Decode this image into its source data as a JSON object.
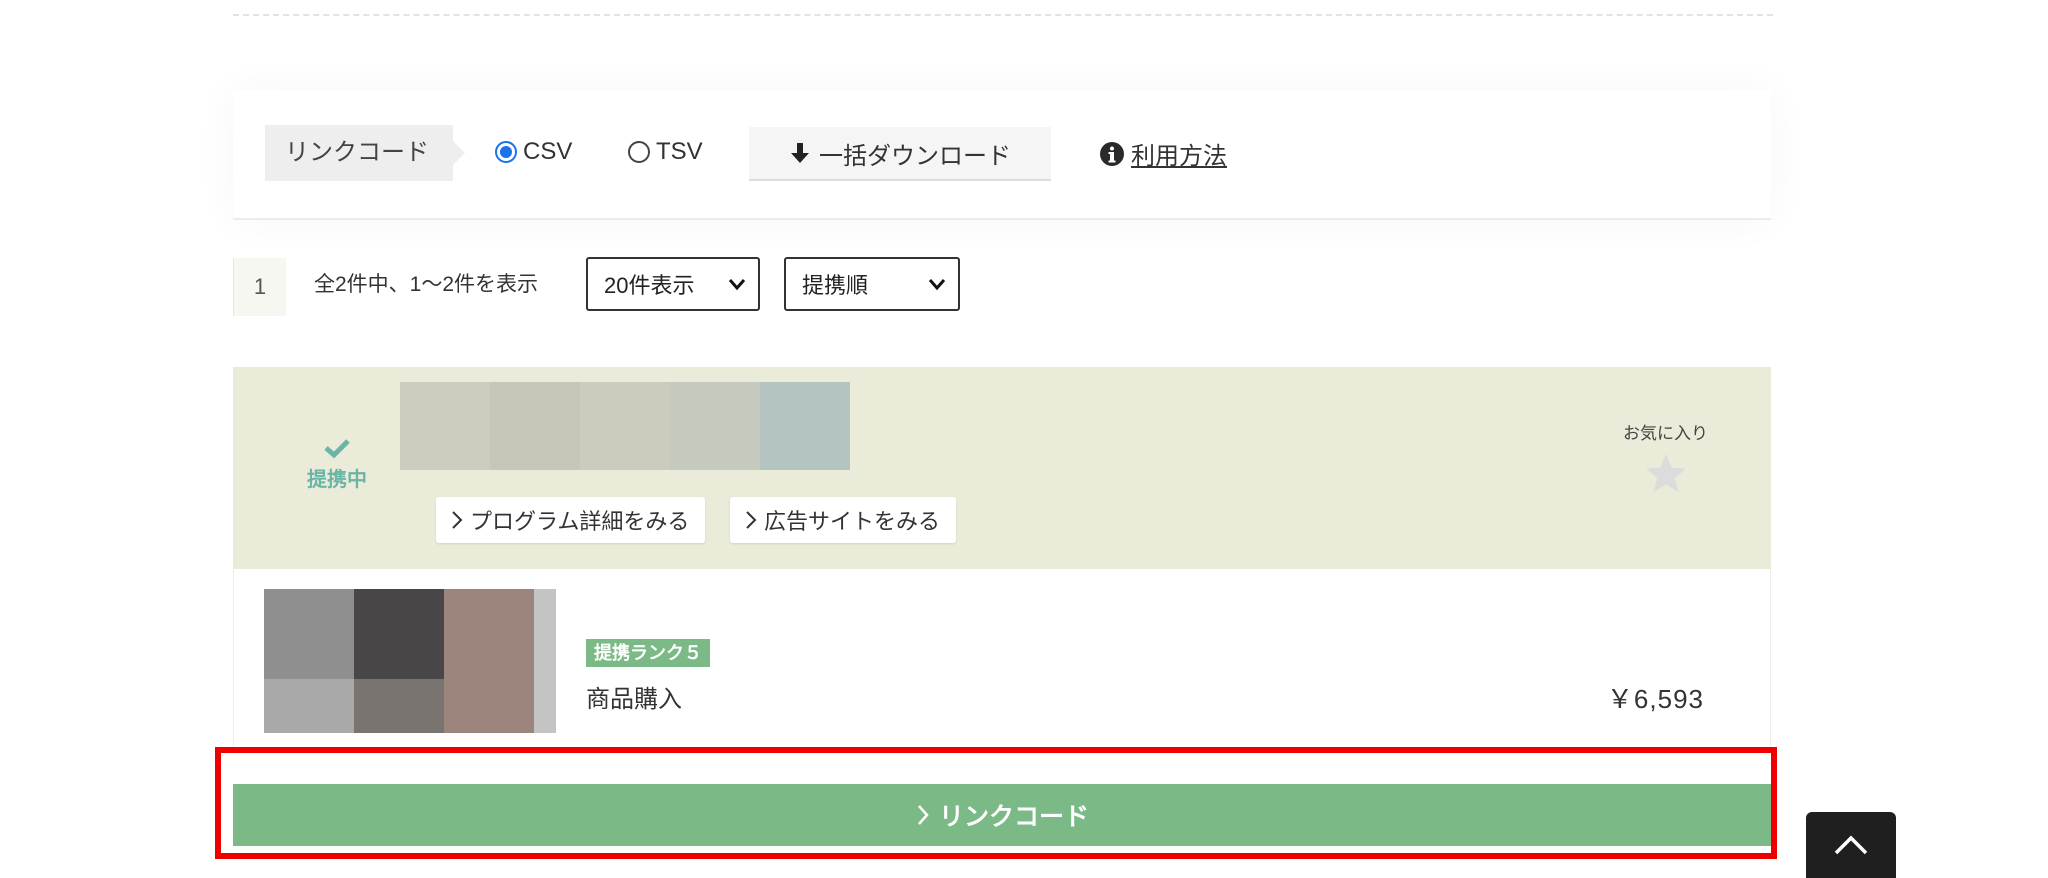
{
  "toolbar": {
    "linkcode_label": "リンクコード",
    "format_options": [
      {
        "label": "CSV",
        "selected": true
      },
      {
        "label": "TSV",
        "selected": false
      }
    ],
    "download_label": "一括ダウンロード",
    "howto_label": "利用方法"
  },
  "pager": {
    "current_page": "1",
    "count_text": "全2件中、1～2件を表示",
    "per_page_selected": "20件表示",
    "sort_selected": "提携順"
  },
  "program": {
    "status_label": "提携中",
    "detail_button": "プログラム詳細をみる",
    "site_button": "広告サイトをみる",
    "favorite_label": "お気に入り",
    "banner_colors": [
      "#ccccbf",
      "#c7c6b9",
      "#cbcbbe",
      "#c6c9be",
      "#b3c4c3"
    ]
  },
  "product": {
    "rank_badge": "提携ランク５",
    "name": "商品購入",
    "price": "￥6,593",
    "image_colors": [
      "#8f8f8f",
      "#484646",
      "#9b857d",
      "#c4c4c4",
      "#a9a9a9",
      "#7a7470",
      "#9b857d",
      "#c4c4c4"
    ]
  },
  "linkcode_button": "リンクコード",
  "colors": {
    "accent_green": "#7bba87",
    "status_teal": "#6bb5a6",
    "program_bg": "#ebebda",
    "highlight_red": "#ee0000",
    "radio_blue": "#1a73e8"
  },
  "icons": [
    "download-arrow-icon",
    "info-icon",
    "chevron-down-icon",
    "check-icon",
    "star-icon",
    "chevron-right-icon",
    "chevron-up-icon"
  ]
}
